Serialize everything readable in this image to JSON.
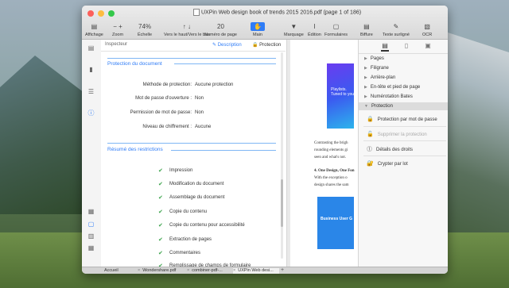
{
  "window": {
    "title": "UXPin Web design book of trends 2015 2016.pdf (page 1 of 186)"
  },
  "toolbar": {
    "items": [
      {
        "icon": "▤",
        "label": "Affichage"
      },
      {
        "icon": "− +",
        "label": "Zoom"
      },
      {
        "icon": "74%",
        "label": "Échelle"
      },
      {
        "icon": "↑ ↓",
        "label": "Vers le haut/Vers le bas"
      },
      {
        "icon": "20",
        "label": "Numéro de page"
      },
      {
        "icon": "✋",
        "label": "Main"
      },
      {
        "icon": "▼",
        "label": "Marquage"
      },
      {
        "icon": "I",
        "label": "Édition"
      },
      {
        "icon": "▢",
        "label": "Formulaires"
      },
      {
        "icon": "▤",
        "label": "Biffure"
      },
      {
        "icon": "✎",
        "label": "Texte surligné"
      },
      {
        "icon": "▧",
        "label": "OCR"
      }
    ]
  },
  "inspector": {
    "title": "Inspecteur",
    "description_label": "Description",
    "protection_label": "Protection",
    "section1": "Protection du document",
    "rows": [
      {
        "label": "Méthode de protection:",
        "value": "Aucune protection"
      },
      {
        "label": "Mot de passe d'ouverture :",
        "value": "Non"
      },
      {
        "label": "Permission de mot de passe:",
        "value": "Non"
      },
      {
        "label": "Niveau de chiffrement :",
        "value": "Aucune"
      }
    ],
    "section2": "Résumé des restrictions",
    "restrictions": [
      "Impression",
      "Modification du document",
      "Assemblage du document",
      "Copie du contenu",
      "Copie du contenu pour accessibilité",
      "Extraction de pages",
      "Commentaires",
      "Remplissage de champs de formulaire"
    ]
  },
  "document": {
    "phone1_text": "Playlists. Tuned to you",
    "text_lines": [
      "Contrasting the brigh",
      "rounding elements gi",
      "seen and what's not.",
      "4. One Design, One Fon",
      "With the exception o",
      "design shares the sam"
    ],
    "phone2_text": "Business User G"
  },
  "right_panel": {
    "tree": [
      "Pages",
      "Filigrane",
      "Arrière-plan",
      "En-tête et pied de page",
      "Numérotation Bates",
      "Protection"
    ],
    "actions": [
      {
        "icon": "🔒",
        "label": "Protection par mot de passe",
        "enabled": true
      },
      {
        "icon": "🔓",
        "label": "Supprimer la protection",
        "enabled": false
      },
      {
        "icon": "⓵",
        "label": "Détails des droits",
        "enabled": true
      },
      {
        "icon": "🔐",
        "label": "Crypter par lot",
        "enabled": true
      }
    ]
  },
  "tabs": [
    {
      "label": "Accueil"
    },
    {
      "label": "Wondershare.pdf"
    },
    {
      "label": "combiner-pdf-..."
    },
    {
      "label": "UXPin Web desi..."
    }
  ],
  "colors": {
    "accent": "#2f7cf6",
    "check": "#3aa34a"
  }
}
